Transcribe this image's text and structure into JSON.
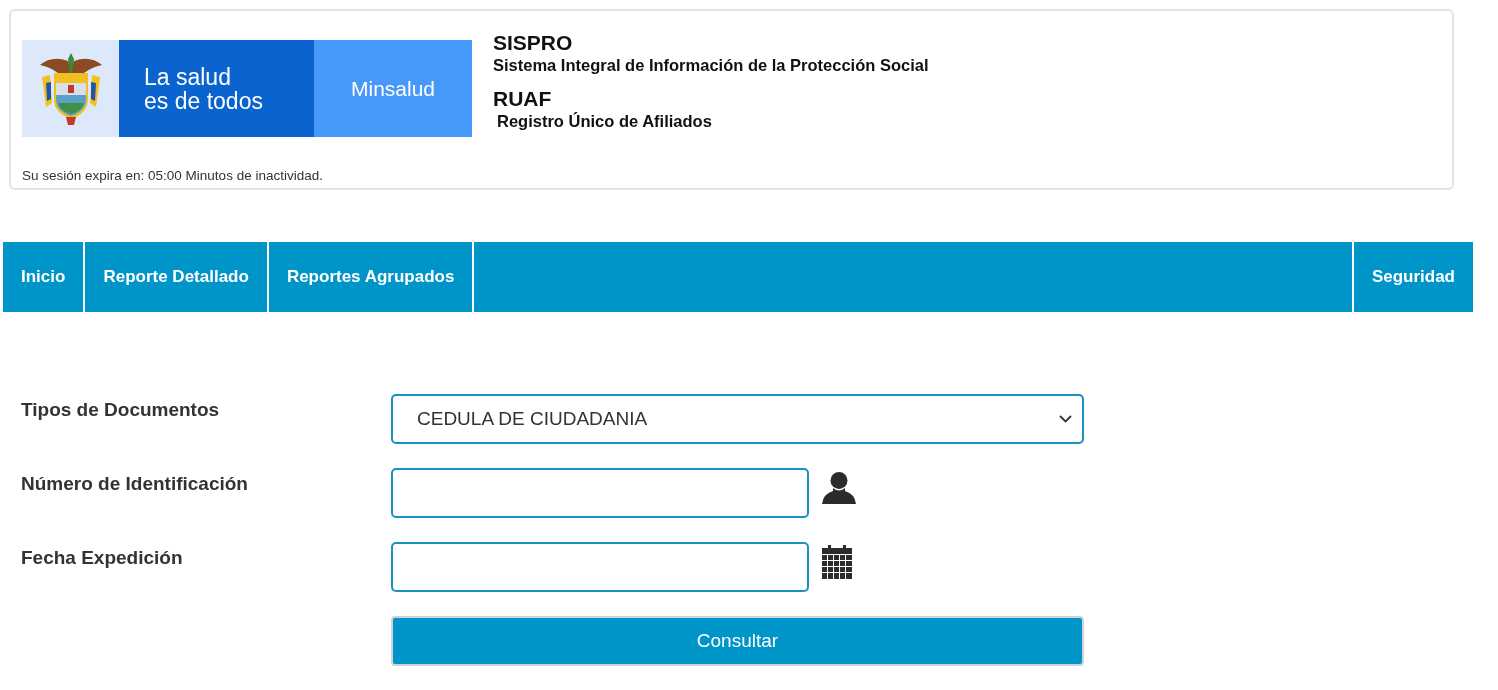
{
  "header": {
    "logo": {
      "slogan_lines": [
        "La salud",
        "es de todos"
      ],
      "brand": "Minsalud"
    },
    "system": {
      "name": "SISPRO",
      "description": "Sistema Integral de Información de la Protección Social"
    },
    "module": {
      "name": "RUAF",
      "description": "Registro Único de Afiliados"
    },
    "session_notice": "Su sesión expira en: 05:00 Minutos de inactividad."
  },
  "menu": {
    "items": [
      {
        "label": "Inicio"
      },
      {
        "label": "Reporte Detallado"
      },
      {
        "label": "Reportes Agrupados"
      }
    ],
    "right_items": [
      {
        "label": "Seguridad"
      }
    ]
  },
  "form": {
    "fields": [
      {
        "kind": "select",
        "label": "Tipos de Documentos",
        "value": "CEDULA DE CIUDADANIA"
      },
      {
        "kind": "text",
        "label": "Número de Identificación"
      },
      {
        "kind": "date",
        "label": "Fecha Expedición"
      }
    ],
    "submit": {
      "label": "Consultar"
    }
  }
}
